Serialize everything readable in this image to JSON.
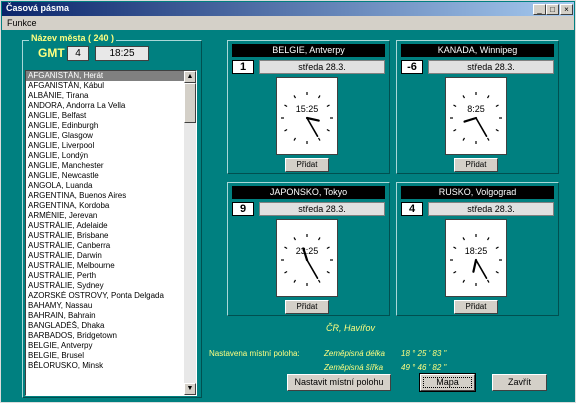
{
  "window": {
    "title": "Časová pásma"
  },
  "menu": {
    "funkce": "Funkce"
  },
  "cities": {
    "group_label": "Název města  ( 240 )",
    "gmt_label": "GMT",
    "gmt_offset": "4",
    "gmt_time": "18:25",
    "items": [
      "AFGANISTÁN, Herát",
      "AFGANISTÁN, Kábul",
      "ALBÁNIE, Tirana",
      "ANDORA, Andorra La Vella",
      "ANGLIE, Belfast",
      "ANGLIE, Edinburgh",
      "ANGLIE, Glasgow",
      "ANGLIE, Liverpool",
      "ANGLIE, Londýn",
      "ANGLIE, Manchester",
      "ANGLIE, Newcastle",
      "ANGOLA, Luanda",
      "ARGENTINA, Buenos Aires",
      "ARGENTINA, Kordoba",
      "ARMÉNIE, Jerevan",
      "AUSTRÁLIE, Adelaide",
      "AUSTRÁLIE, Brisbane",
      "AUSTRÁLIE, Canberra",
      "AUSTRÁLIE, Darwin",
      "AUSTRÁLIE, Melbourne",
      "AUSTRÁLIE, Perth",
      "AUSTRÁLIE, Sydney",
      "AZORSKÉ OSTROVY, Ponta Delgada",
      "BAHAMY, Nassau",
      "BAHRAIN, Bahrain",
      "BANGLADÉŠ, Dhaka",
      "BARBADOS, Bridgetown",
      "BELGIE, Antverpy",
      "BELGIE, Brusel",
      "BĚLORUSKO, Minsk"
    ],
    "selected_index": 0
  },
  "clocks": [
    {
      "city": "BELGIE, Antverpy",
      "offset": "1",
      "day": "středa  28.3.",
      "time": "15:25",
      "hour": 15,
      "minute": 25,
      "add": "Přidat"
    },
    {
      "city": "KANADA, Winnipeg",
      "offset": "-6",
      "day": "středa  28.3.",
      "time": "8:25",
      "hour": 8,
      "minute": 25,
      "add": "Přidat"
    },
    {
      "city": "JAPONSKO, Tokyo",
      "offset": "9",
      "day": "středa  28.3.",
      "time": "23:25",
      "hour": 23,
      "minute": 25,
      "add": "Přidat"
    },
    {
      "city": "RUSKO, Volgograd",
      "offset": "4",
      "day": "středa  28.3.",
      "time": "18:25",
      "hour": 18,
      "minute": 25,
      "add": "Přidat"
    }
  ],
  "location": {
    "city": "ČR, Havířov",
    "label": "Nastavena místní poloha:",
    "lon_label": "Zeměpisná délka",
    "lon_value": "18 °  25 ' 83 \"",
    "lat_label": "Zeměpisná šířka",
    "lat_value": "49 °  46 ' 82 \""
  },
  "buttons": {
    "set_location": "Nastavit místní polohu",
    "map": "Mapa",
    "close": "Zavřít"
  }
}
